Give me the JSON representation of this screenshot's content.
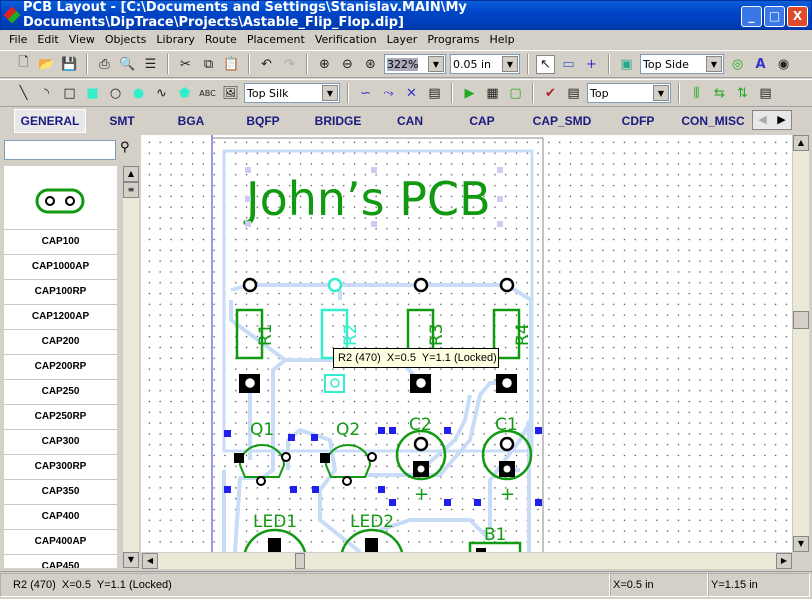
{
  "window": {
    "title": "PCB Layout - [C:\\Documents and Settings\\Stanislav.MAIN\\My Documents\\DipTrace\\Projects\\Astable_Flip_Flop.dip]",
    "minimize": "_",
    "maximize": "□",
    "close": "X"
  },
  "menu": [
    "File",
    "Edit",
    "View",
    "Objects",
    "Library",
    "Route",
    "Placement",
    "Verification",
    "Layer",
    "Programs",
    "Help"
  ],
  "toolbar1": {
    "zoom": "322%",
    "grid": "0.05 in",
    "side": "Top Side"
  },
  "toolbar2": {
    "layer": "Top Silk",
    "route_layer": "Top",
    "text_tool": "ABC"
  },
  "tabs": [
    "GENERAL",
    "SMT",
    "BGA",
    "BQFP",
    "BRIDGE",
    "CAN",
    "CAP",
    "CAP_SMD",
    "CDFP",
    "CON_MISC"
  ],
  "library": {
    "search": "",
    "items": [
      "CAP100",
      "CAP1000AP",
      "CAP100RP",
      "CAP1200AP",
      "CAP200",
      "CAP200RP",
      "CAP250",
      "CAP250RP",
      "CAP300",
      "CAP300RP",
      "CAP350",
      "CAP400",
      "CAP400AP",
      "CAP450"
    ]
  },
  "pcb": {
    "title": "John’s PCB",
    "resistors": [
      "R1",
      "R2",
      "R3",
      "R4"
    ],
    "transistors": [
      "Q1",
      "Q2"
    ],
    "capacitors": [
      "C2",
      "C1"
    ],
    "leds": [
      "LED1",
      "LED2"
    ],
    "bridge": "B1",
    "plus": "+",
    "tooltip": "R2 (470)  X=0.5  Y=1.1 (Locked)"
  },
  "colors": {
    "silk": "#119911",
    "selected": "#33eecc",
    "trace": "#c8dcf8",
    "outline": "#3333cc"
  },
  "status": {
    "info": "R2 (470)  X=0.5  Y=1.1 (Locked)",
    "x": "X=0.5 in",
    "y": "Y=1.15 in"
  }
}
